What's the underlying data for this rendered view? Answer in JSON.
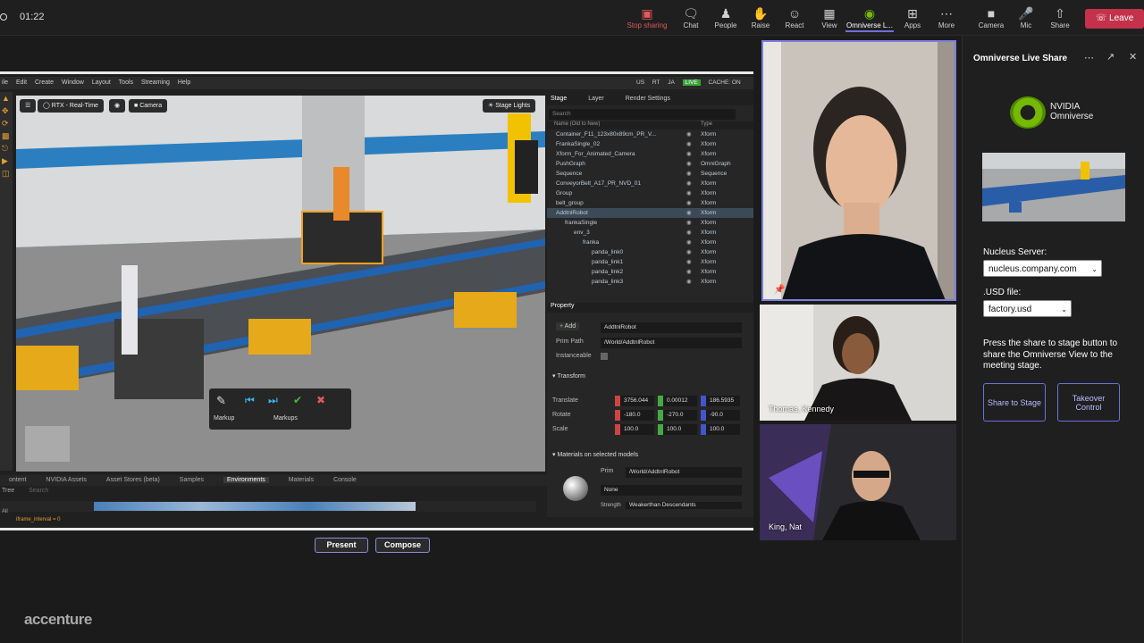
{
  "topbar": {
    "timer": "01:22",
    "stop_sharing": "Stop sharing",
    "chat": "Chat",
    "people": "People",
    "raise": "Raise",
    "react": "React",
    "view": "View",
    "omniverse_app": "Omniverse L...",
    "apps": "Apps",
    "more": "More",
    "camera": "Camera",
    "mic": "Mic",
    "share": "Share",
    "leave": "Leave"
  },
  "app": {
    "menu": [
      "ile",
      "Edit",
      "Create",
      "Window",
      "Layout",
      "Tools",
      "Streaming",
      "Help"
    ],
    "status_tags": [
      "US",
      "RT",
      "JA"
    ],
    "live": "LIVE",
    "cache": "CACHE: ON",
    "viewport": {
      "render_mode": "RTX - Real-Time",
      "camera": "Camera",
      "stage_lights": "Stage Lights"
    },
    "markup": {
      "markup_label": "Markup",
      "markups_label": "Markups"
    },
    "bottom_tabs": [
      "ontent",
      "NVIDIA Assets",
      "Asset Stores (beta)",
      "Samples",
      "Environments",
      "Materials",
      "Console"
    ],
    "tree_label": "Tree",
    "search_label": "Search",
    "all_label": "All",
    "status_line": "iframe_interval = 0",
    "stage": {
      "tabs": [
        "Stage",
        "Layer",
        "Render Settings"
      ],
      "search": "Search",
      "col_name": "Name (Old to New)",
      "col_type": "Type",
      "rows": [
        {
          "name": "Container_F11_123x80x89cm_PR_V...",
          "type": "Xform",
          "indent": 0
        },
        {
          "name": "FrankaSingle_02",
          "type": "Xform",
          "indent": 0
        },
        {
          "name": "Xform_For_Animated_Camera",
          "type": "Xform",
          "indent": 0
        },
        {
          "name": "PushGraph",
          "type": "OmniGraph",
          "indent": 0
        },
        {
          "name": "Sequence",
          "type": "Sequence",
          "indent": 0
        },
        {
          "name": "ConveyorBelt_A17_PR_NVD_01",
          "type": "Xform",
          "indent": 0
        },
        {
          "name": "Group",
          "type": "Xform",
          "indent": 0
        },
        {
          "name": "belt_group",
          "type": "Xform",
          "indent": 0
        },
        {
          "name": "AddtnlRobot",
          "type": "Xform",
          "indent": 0
        },
        {
          "name": "frankaSingle",
          "type": "Xform",
          "indent": 1
        },
        {
          "name": "env_3",
          "type": "Xform",
          "indent": 2
        },
        {
          "name": "franka",
          "type": "Xform",
          "indent": 3
        },
        {
          "name": "panda_link0",
          "type": "Xform",
          "indent": 4
        },
        {
          "name": "panda_link1",
          "type": "Xform",
          "indent": 4
        },
        {
          "name": "panda_link2",
          "type": "Xform",
          "indent": 4
        },
        {
          "name": "panda_link3",
          "type": "Xform",
          "indent": 4
        }
      ]
    },
    "property": {
      "tab": "Property",
      "add": "Add",
      "name_value": "AddtnlRobot",
      "prim_path_label": "Prim Path",
      "prim_path": "/World/AddtnlRobot",
      "instanceable": "Instanceable",
      "transform": "Transform",
      "translate_label": "Translate",
      "translate": [
        "3756.044",
        "0.00012",
        "186.5935"
      ],
      "rotate_label": "Rotate",
      "rotate": [
        "-180.0",
        "-270.0",
        "-90.0"
      ],
      "scale_label": "Scale",
      "scale": [
        "100.0",
        "100.0",
        "100.0"
      ],
      "materials": "Materials on selected models",
      "prim_label": "Prim",
      "prim": "/World/AddtnlRobot",
      "material": "None",
      "strength_label": "Strength",
      "strength": "Weakerthan Descendants"
    }
  },
  "buttons": {
    "present": "Present",
    "compose": "Compose"
  },
  "logo": "accenture",
  "participants": [
    {
      "name": ""
    },
    {
      "name": "Thomas, Kennedy"
    },
    {
      "name": "King, Nat"
    }
  ],
  "side": {
    "title": "Omniverse Live Share",
    "brand_line1": "NVIDIA",
    "brand_line2": "Omniverse",
    "nucleus_label": "Nucleus Server:",
    "nucleus_value": "nucleus.company.com",
    "usd_label": ".USD file:",
    "usd_value": "factory.usd",
    "instructions": "Press the share to stage button to share the Omniverse View to the meeting stage.",
    "share_btn": "Share to Stage",
    "takeover_btn": "Takeover Control"
  },
  "colors": {
    "accent": "#6c70d8",
    "leave": "#c4314b",
    "live": "#3aa53a",
    "nvidia": "#76b900"
  }
}
